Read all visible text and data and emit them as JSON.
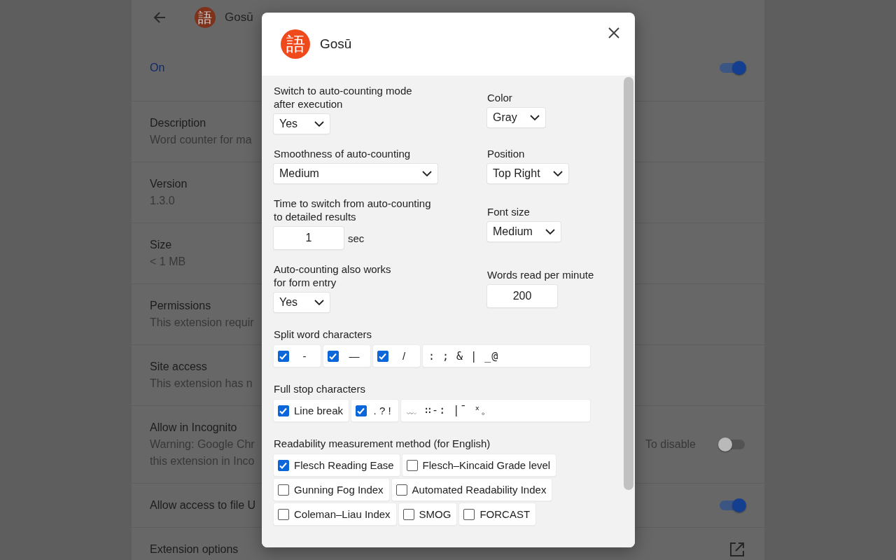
{
  "page": {
    "header": {
      "title": "Gosū",
      "logo_glyph": "語"
    },
    "rows": [
      {
        "kind": "status",
        "title": "On",
        "on": true
      },
      {
        "kind": "info",
        "title": "Description",
        "lines": [
          "Word counter for ma"
        ]
      },
      {
        "kind": "info",
        "title": "Version",
        "lines": [
          "1.3.0"
        ]
      },
      {
        "kind": "info",
        "title": "Size",
        "lines": [
          "< 1 MB"
        ]
      },
      {
        "kind": "info",
        "title": "Permissions",
        "lines": [
          "This extension requir"
        ]
      },
      {
        "kind": "info",
        "title": "Site access",
        "lines": [
          "This extension has n"
        ]
      },
      {
        "kind": "toggle",
        "title": "Allow in Incognito",
        "lines": [
          "Warning: Google Chr",
          "this extension in Inco"
        ],
        "trailing": "To disable",
        "on": false
      },
      {
        "kind": "toggle",
        "title": "Allow access to file U",
        "on": true
      },
      {
        "kind": "link",
        "title": "Extension options"
      }
    ]
  },
  "dialog": {
    "title": "Gosū",
    "logo_glyph": "語",
    "settings": [
      {
        "left": {
          "label": "Switch to auto-counting mode\nafter execution",
          "kind": "select",
          "value": "Yes"
        },
        "right": {
          "label": "Color",
          "kind": "select",
          "value": "Gray"
        }
      },
      {
        "left": {
          "label": "Smoothness of auto-counting",
          "kind": "select",
          "value": "Medium",
          "wide": true
        },
        "right": {
          "label": "Position",
          "kind": "select",
          "value": "Top Right"
        }
      },
      {
        "left": {
          "label": "Time to switch from auto-counting\nto detailed results",
          "kind": "number",
          "value": "1",
          "unit": "sec"
        },
        "right": {
          "label": "Font size",
          "kind": "select",
          "value": "Medium"
        }
      },
      {
        "left": {
          "label": "Auto-counting also works\nfor form entry",
          "kind": "select",
          "value": "Yes"
        },
        "right": {
          "label": "Words read per minute",
          "kind": "number",
          "value": "200"
        }
      }
    ],
    "groups": [
      {
        "label": "Split word characters",
        "items": [
          {
            "kind": "check",
            "label": "-",
            "checked": true
          },
          {
            "kind": "check",
            "label": "—",
            "checked": true
          },
          {
            "kind": "check",
            "label": "/",
            "checked": true
          },
          {
            "kind": "field",
            "value": ": ; & | _@"
          }
        ]
      },
      {
        "label": "Full stop characters",
        "items": [
          {
            "kind": "check",
            "label": "Line break",
            "checked": true
          },
          {
            "kind": "check",
            "label": ". ? !",
            "checked": true
          },
          {
            "kind": "field",
            "value": "﹏ ∷-: |¯ ˣ。"
          }
        ]
      },
      {
        "label": "Readability measurement method (for English)",
        "items": [
          {
            "kind": "check",
            "label": "Flesch Reading Ease",
            "checked": true
          },
          {
            "kind": "check",
            "label": "Flesch–Kincaid Grade level",
            "checked": false
          },
          {
            "kind": "check",
            "label": "Gunning Fog Index",
            "checked": false
          },
          {
            "kind": "check",
            "label": "Automated Readability Index",
            "checked": false
          },
          {
            "kind": "check",
            "label": "Coleman–Liau Index",
            "checked": false
          },
          {
            "kind": "check",
            "label": "SMOG",
            "checked": false
          },
          {
            "kind": "check",
            "label": "FORCAST",
            "checked": false
          }
        ]
      }
    ]
  }
}
